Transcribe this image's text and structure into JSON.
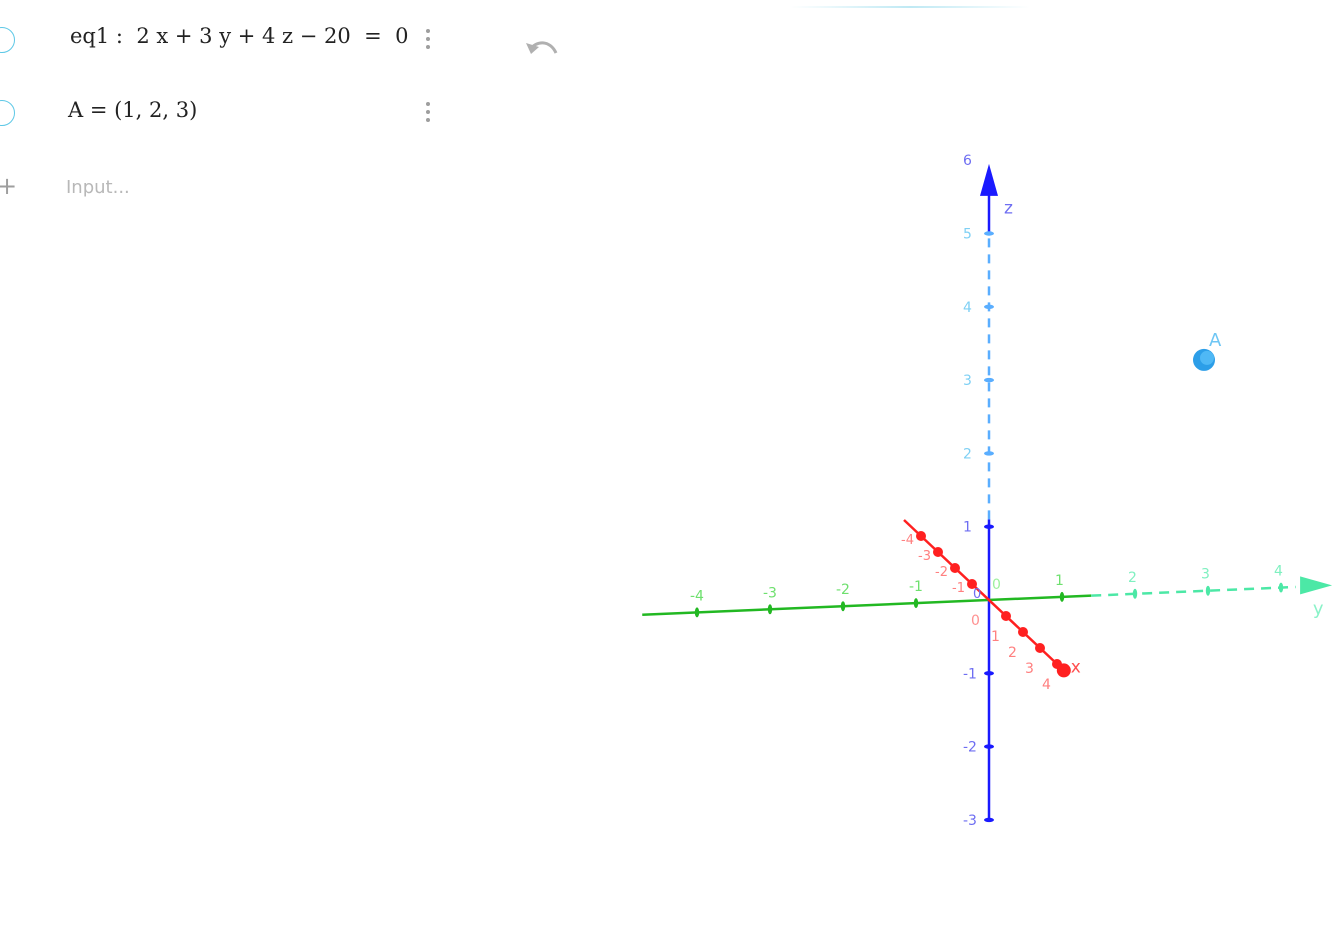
{
  "algebra": {
    "items": [
      {
        "label": "eq1 :  2 x + 3 y + 4 z − 20  =  0"
      },
      {
        "label": "A = (1, 2, 3)"
      }
    ],
    "input_placeholder": "Input..."
  },
  "icons": {
    "undo": "undo-icon",
    "add": "plus-icon",
    "menu": "more-vertical-icon",
    "visibility": "visibility-toggle-icon"
  },
  "graphics3d": {
    "axes": {
      "x_label": "x",
      "y_label": "y",
      "z_label": "z"
    },
    "x_ticks": [
      -4,
      -3,
      -2,
      -1,
      0,
      1,
      2,
      3,
      4
    ],
    "y_ticks": [
      -4,
      -3,
      -2,
      -1,
      0,
      1,
      2,
      3,
      4
    ],
    "z_ticks": [
      -3,
      -2,
      -1,
      0,
      1,
      2,
      3,
      4,
      5,
      6
    ],
    "point": {
      "name": "A",
      "x": 1,
      "y": 2,
      "z": 3
    },
    "colors": {
      "x_axis": "#ff2020",
      "y_axis": "#22b822",
      "z_axis": "#1a1aff",
      "point": "#2c9ee8"
    }
  }
}
